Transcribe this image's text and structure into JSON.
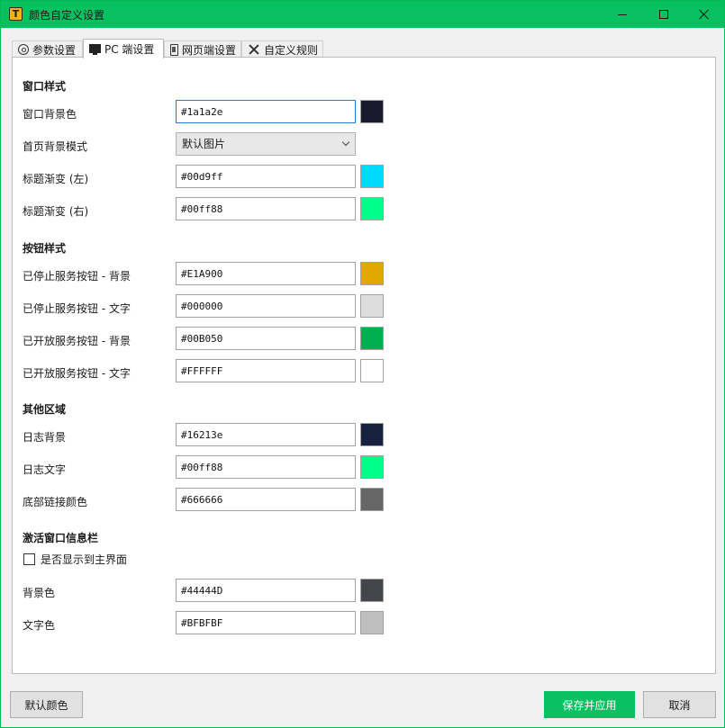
{
  "window": {
    "title": "颜色自定义设置",
    "app_icon_glyph": "T"
  },
  "tabs": [
    {
      "label": "参数设置",
      "icon": "gear-icon"
    },
    {
      "label": "PC 端设置",
      "icon": "monitor-icon",
      "active": true
    },
    {
      "label": "网页端设置",
      "icon": "phone-icon"
    },
    {
      "label": "自定义规则",
      "icon": "tools-icon"
    }
  ],
  "sections": {
    "window_style": "窗口样式",
    "button_style": "按钮样式",
    "other_area": "其他区域",
    "active_info_bar": "激活窗口信息栏"
  },
  "fields": {
    "window_bg": {
      "label": "窗口背景色",
      "value": "#1a1a2e",
      "swatch": "#1a1a2e"
    },
    "home_bg_mode": {
      "label": "首页背景模式",
      "value": "默认图片"
    },
    "title_grad_left": {
      "label": "标题渐变 (左)",
      "value": "#00d9ff",
      "swatch": "#00d9ff"
    },
    "title_grad_right": {
      "label": "标题渐变 (右)",
      "value": "#00ff88",
      "swatch": "#00ff88"
    },
    "stopped_btn_bg": {
      "label": "已停止服务按钮 - 背景",
      "value": "#E1A900",
      "swatch": "#E1A900"
    },
    "stopped_btn_text": {
      "label": "已停止服务按钮 - 文字",
      "value": "#000000",
      "swatch": "#DDDDDD"
    },
    "started_btn_bg": {
      "label": "已开放服务按钮 - 背景",
      "value": "#00B050",
      "swatch": "#00B050"
    },
    "started_btn_text": {
      "label": "已开放服务按钮 - 文字",
      "value": "#FFFFFF",
      "swatch": "#FFFFFF"
    },
    "log_bg": {
      "label": "日志背景",
      "value": "#16213e",
      "swatch": "#16213e"
    },
    "log_text": {
      "label": "日志文字",
      "value": "#00ff88",
      "swatch": "#00ff88"
    },
    "footer_link": {
      "label": "底部链接颜色",
      "value": "#666666",
      "swatch": "#666666"
    },
    "show_on_main": {
      "label": "是否显示到主界面",
      "checked": false
    },
    "info_bg": {
      "label": "背景色",
      "value": "#44444D",
      "swatch": "#44444D"
    },
    "info_text": {
      "label": "文字色",
      "value": "#BFBFBF",
      "swatch": "#BFBFBF"
    }
  },
  "buttons": {
    "default_colors": "默认颜色",
    "save_apply": "保存并应用",
    "cancel": "取消"
  },
  "colors": {
    "accent": "#07c160"
  }
}
